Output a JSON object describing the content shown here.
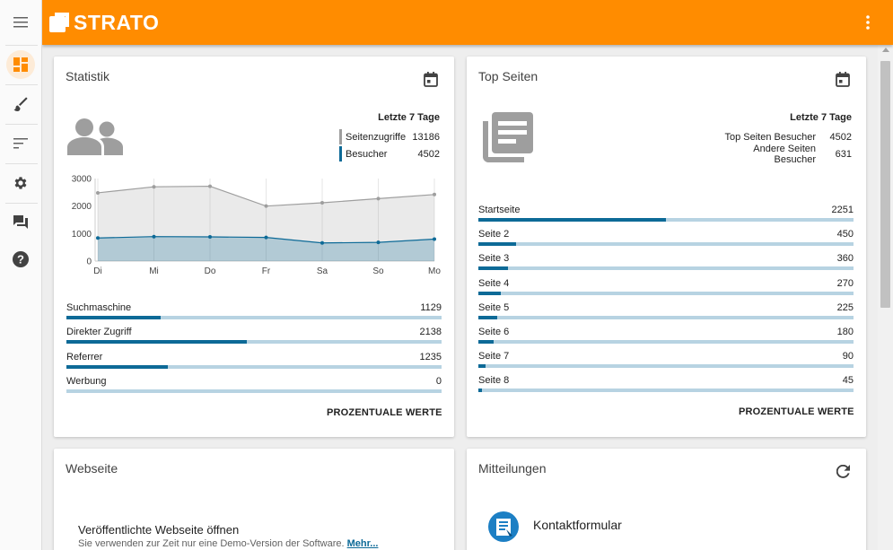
{
  "app": {
    "brand": "STRATO"
  },
  "sidebar": {
    "items": [
      {
        "icon": "menu-icon"
      },
      {
        "icon": "dashboard-icon",
        "active": true
      },
      {
        "icon": "brush-icon"
      },
      {
        "icon": "sort-icon"
      },
      {
        "icon": "gear-icon"
      },
      {
        "icon": "chat-icon"
      },
      {
        "icon": "help-icon"
      }
    ]
  },
  "statistik": {
    "title": "Statistik",
    "period": "Letzte 7 Tage",
    "legend": [
      {
        "name": "Seitenzugriffe",
        "value": "13186",
        "color": "#9e9e9e"
      },
      {
        "name": "Besucher",
        "value": "4502",
        "color": "#0d6a97"
      }
    ],
    "sources": [
      {
        "label": "Suchmaschine",
        "value": "1129",
        "fraction": 0.25
      },
      {
        "label": "Direkter Zugriff",
        "value": "2138",
        "fraction": 0.48
      },
      {
        "label": "Referrer",
        "value": "1235",
        "fraction": 0.27
      },
      {
        "label": "Werbung",
        "value": "0",
        "fraction": 0.0
      }
    ],
    "button": "PROZENTUALE WERTE"
  },
  "chart_data": {
    "type": "area",
    "categories": [
      "Di",
      "Mi",
      "Do",
      "Fr",
      "Sa",
      "So",
      "Mo"
    ],
    "series": [
      {
        "name": "Seitenzugriffe",
        "values": [
          2480,
          2700,
          2720,
          2000,
          2120,
          2270,
          2420
        ],
        "color": "#9e9e9e"
      },
      {
        "name": "Besucher",
        "values": [
          840,
          890,
          880,
          860,
          660,
          680,
          800
        ],
        "color": "#0d6a97"
      }
    ],
    "yticks": [
      "0",
      "1000",
      "2000",
      "3000"
    ],
    "ylim": [
      0,
      3000
    ],
    "grid": "vertical"
  },
  "top_seiten": {
    "title": "Top Seiten",
    "period": "Letzte 7 Tage",
    "summary": [
      {
        "name": "Top Seiten Besucher",
        "value": "4502"
      },
      {
        "name": "Andere Seiten Besucher",
        "value": "631"
      }
    ],
    "pages": [
      {
        "label": "Startseite",
        "value": "2251",
        "fraction": 0.5
      },
      {
        "label": "Seite 2",
        "value": "450",
        "fraction": 0.1
      },
      {
        "label": "Seite 3",
        "value": "360",
        "fraction": 0.08
      },
      {
        "label": "Seite 4",
        "value": "270",
        "fraction": 0.06
      },
      {
        "label": "Seite 5",
        "value": "225",
        "fraction": 0.05
      },
      {
        "label": "Seite 6",
        "value": "180",
        "fraction": 0.04
      },
      {
        "label": "Seite 7",
        "value": "90",
        "fraction": 0.02
      },
      {
        "label": "Seite 8",
        "value": "45",
        "fraction": 0.01
      }
    ],
    "button": "PROZENTUALE WERTE"
  },
  "webseite": {
    "title": "Webseite",
    "heading": "Veröffentlichte Webseite öffnen",
    "text": "Sie verwenden zur Zeit nur eine Demo-Version der Software.",
    "link": "Mehr..."
  },
  "mitteilungen": {
    "title": "Mitteilungen",
    "item": "Kontaktformular"
  },
  "colors": {
    "accent": "#ff8c00",
    "bar": "#0d6a97",
    "bar_track": "#b7d3e2"
  }
}
